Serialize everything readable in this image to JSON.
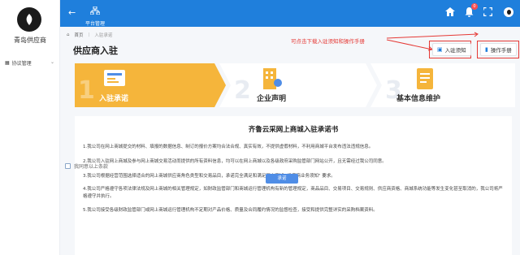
{
  "sidebar": {
    "logo_text": "青岛供应商",
    "menu": [
      {
        "label": "协议管理"
      }
    ]
  },
  "header": {
    "nav_center_label": "平台管理",
    "notification_count": "0",
    "accent": "#1f7fdc"
  },
  "breadcrumb": {
    "home": "首页",
    "current": "入驻承诺"
  },
  "page": {
    "title": "供应商入驻",
    "hint": "可点击下载入驻须知和操作手册",
    "notice_button": "入驻须知",
    "manual_button": "操作手册"
  },
  "steps": [
    {
      "num": "1",
      "label": "入驻承诺",
      "active": true
    },
    {
      "num": "2",
      "label": "企业声明",
      "active": false
    },
    {
      "num": "3",
      "label": "基本信息维护",
      "active": false
    }
  ],
  "document": {
    "title": "齐鲁云采网上商城入驻承诺书",
    "paragraphs": [
      "1.我公司在网上商城提交的材料、填报的数据信息、制订的报价方案均合法合规、真实有效，不提供虚假材料，不利用商城平台发布违法违规信息。",
      "2.我公司入驻网上商城及参与网上商城交易活动而提供的所有资料信息，均可以在网上商城以及各级政府采购监管部门网站公开，且无需经过我公司同意。",
      "3.我公司根据经营范围选择适合的网上商城供应商角色类型和交易品目，承诺完全满足和满足网上商城 \"供应商业务须知\" 要求。",
      "4.我公司严格遵守各项法律法规及网上商城的相关管理规定，如财政监管部门和商城运行管理机构有新的管理规定，商品品目、交易项目、交易规则、供应商资格、商城系统功能等发生变化甚至取消的，我公司将严格遵守并执行。",
      "5.我公司接受各级财政监管部门或网上商城运行管理机构不定期对产品价格、质量及合同履约情况的监督检查，接受和提供完整详实的采购档案资料。"
    ],
    "agree_label": "我同意以上条款",
    "submit_label": "承诺"
  }
}
